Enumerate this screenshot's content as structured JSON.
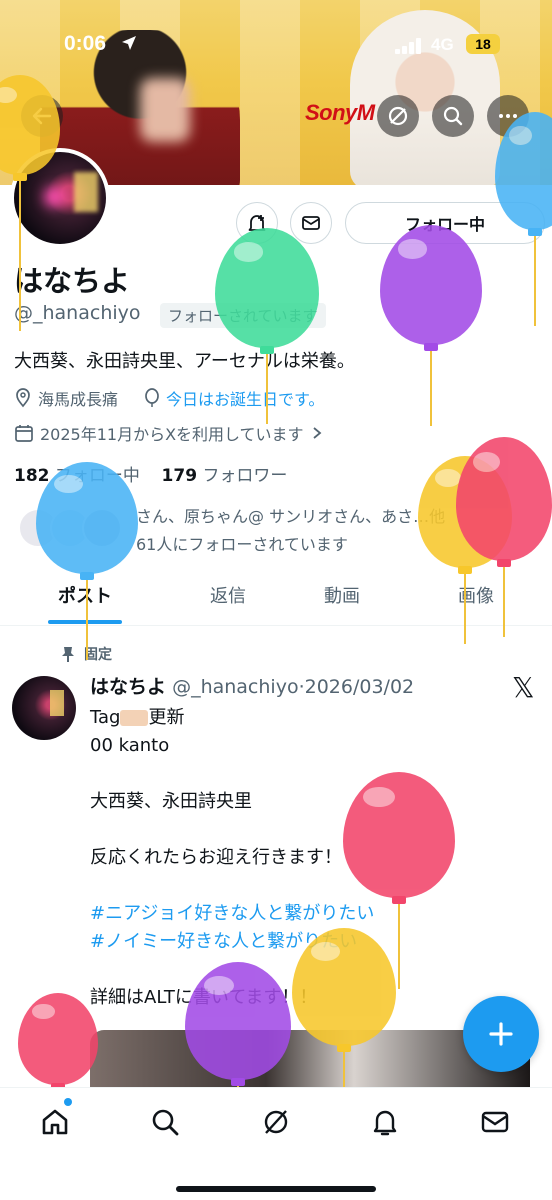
{
  "status_bar": {
    "time": "0:06",
    "network": "4G",
    "battery": "18"
  },
  "banner": {
    "logo_text": "SonyM"
  },
  "profile": {
    "name": "はなちよ",
    "handle": "@_hanachiyo",
    "follows_you": "フォローされています",
    "bio": "大西葵、永田詩央里、アーセナルは栄養。",
    "location": "海馬成長痛",
    "birthday": "今日はお誕生日です。",
    "joined": "2025年11月からXを利用しています",
    "following_count": "182",
    "following_label": "フォロー中",
    "followers_count": "179",
    "followers_label": "フォロワー",
    "followed_by_line1": "さん、原ちゃん@ サンリオさん、あさ…他",
    "followed_by_line2": "61人にフォローされています"
  },
  "buttons": {
    "follow": "フォロー中"
  },
  "tabs": [
    {
      "label": "ポスト"
    },
    {
      "label": "返信"
    },
    {
      "label": "動画"
    },
    {
      "label": "画像"
    }
  ],
  "pinned_label": "固定",
  "post": {
    "name": "はなちよ",
    "handle": "@_hanachiyo",
    "date": "2026/03/02",
    "lines": {
      "l1_prefix": "Tag",
      "l1_suffix": "更新",
      "l2": "00 kanto",
      "l3": "大西葵、永田詩央里",
      "l4": "反応くれたらお迎え行きます！",
      "l5": "#ニアジョイ好きな人と繋がりたい",
      "l6": "#ノイミー好きな人と繋がりたい",
      "l7": "詳細はALTに書いてます！！"
    }
  },
  "colors": {
    "accent": "#1d9bf0",
    "balloon_green": "#3fdc9a",
    "balloon_purple": "#a24be6",
    "balloon_pink": "#f2456b",
    "balloon_yellow": "#f7c72b",
    "balloon_blue": "#48b3f5"
  },
  "icons": {
    "back": "back-arrow-icon",
    "explore": "slashed-circle-icon",
    "search": "search-icon",
    "more": "more-icon",
    "notify": "bell-plus-icon",
    "message": "envelope-icon",
    "location": "pin-icon",
    "birthday": "balloon-icon",
    "joined": "calendar-icon",
    "pinned": "pushpin-icon",
    "compose": "plus-icon",
    "nav": [
      "home-icon",
      "search-icon",
      "grok-icon",
      "bell-icon",
      "mail-icon"
    ]
  }
}
